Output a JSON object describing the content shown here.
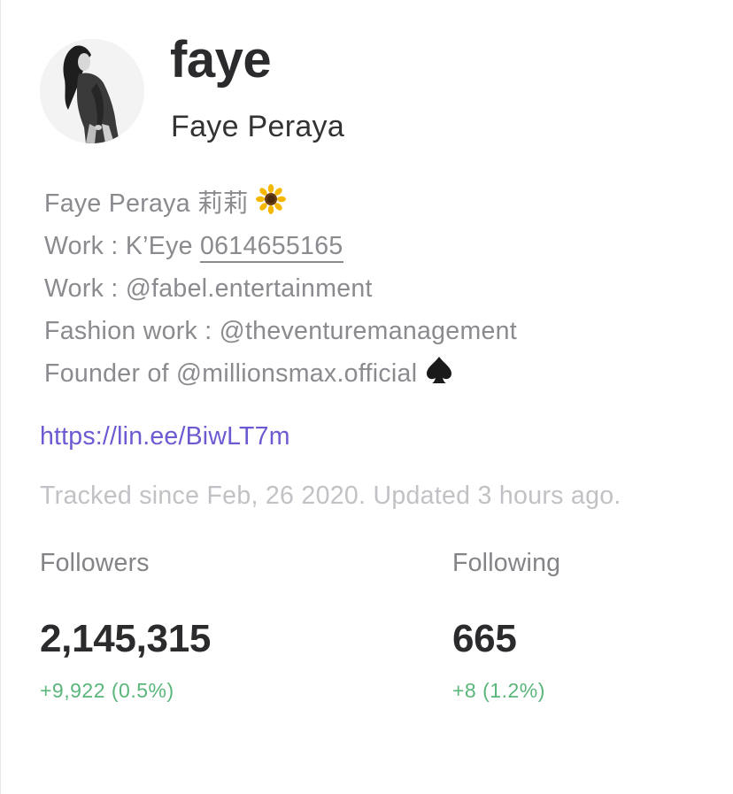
{
  "profile": {
    "username": "faye",
    "full_name": "Faye Peraya",
    "avatar_icon": "profile-photo"
  },
  "bio": {
    "line1": "Faye Peraya 莉莉",
    "line1_emoji": "sunflower-icon",
    "line2_prefix": "Work : K’Eye ",
    "line2_phone": "0614655165",
    "line3": "Work : @fabel.entertainment",
    "line4": "Fashion work : @theventuremanagement",
    "line5": "Founder of @millionsmax.official",
    "line5_emoji": "spade-icon"
  },
  "link": {
    "url": "https://lin.ee/BiwLT7m"
  },
  "tracking": {
    "text": "Tracked since Feb, 26 2020. Updated 3 hours ago."
  },
  "stats": {
    "followers": {
      "label": "Followers",
      "value": "2,145,315",
      "change": "+9,922 (0.5%)"
    },
    "following": {
      "label": "Following",
      "value": "665",
      "change": "+8 (1.2%)"
    }
  },
  "colors": {
    "link": "#6b5bd2",
    "positive_change": "#5ab67b",
    "muted_text": "#8a8a8f",
    "faint_text": "#c2c2c6",
    "primary_text": "#2b2b2e"
  }
}
